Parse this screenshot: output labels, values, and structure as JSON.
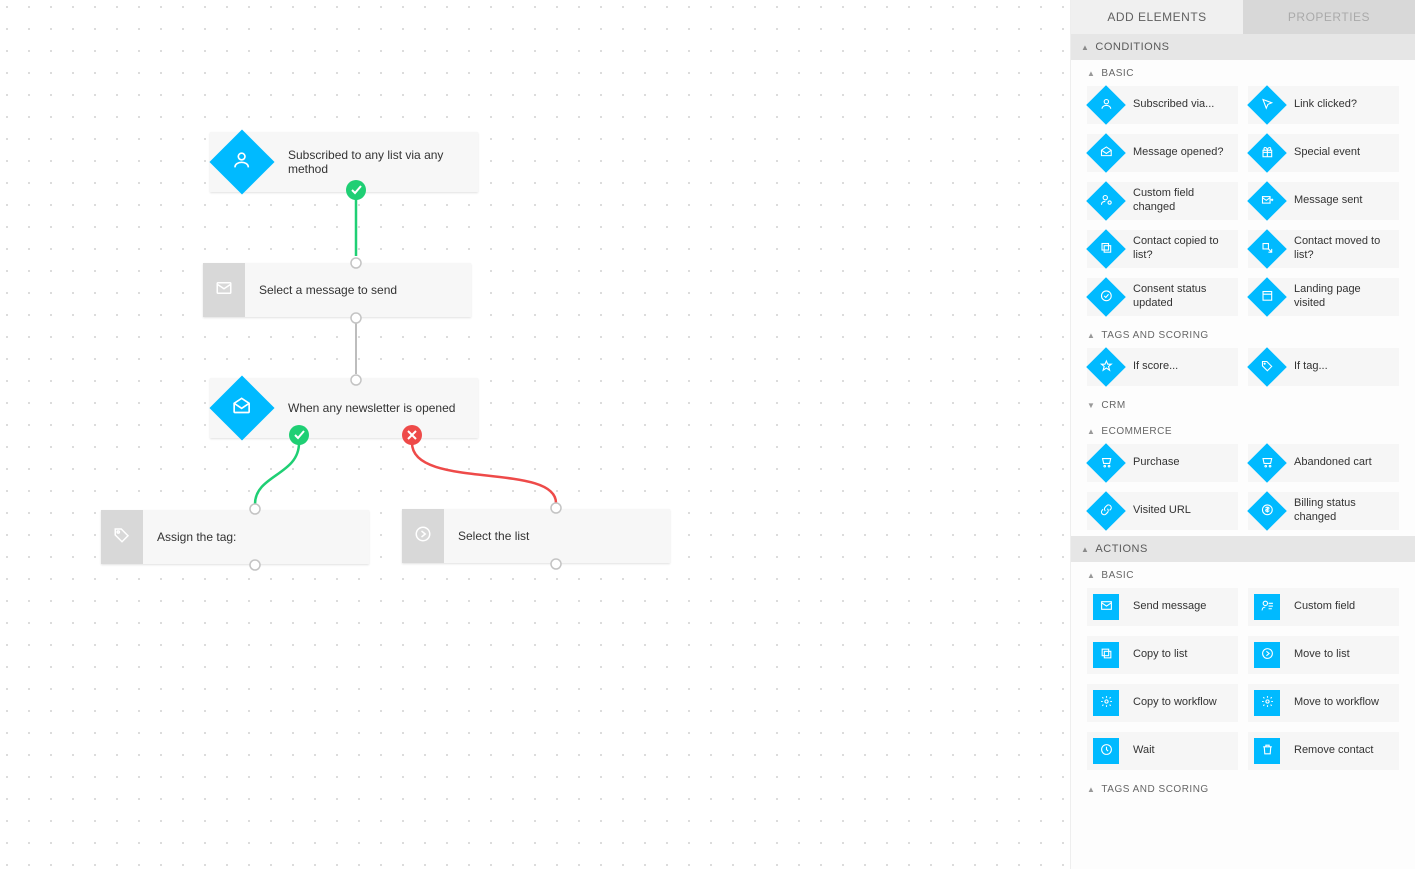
{
  "tabs": {
    "add": "ADD ELEMENTS",
    "props": "PROPERTIES"
  },
  "sections": {
    "conditions": "CONDITIONS",
    "actions": "ACTIONS",
    "basic": "BASIC",
    "tags_scoring": "TAGS AND SCORING",
    "crm": "CRM",
    "ecommerce": "ECOMMERCE"
  },
  "conditions": {
    "basic": [
      {
        "label": "Subscribed via...",
        "icon": "person"
      },
      {
        "label": "Link clicked?",
        "icon": "cursor"
      },
      {
        "label": "Message opened?",
        "icon": "mail-open"
      },
      {
        "label": "Special event",
        "icon": "gift"
      },
      {
        "label": "Custom field changed",
        "icon": "person-gear"
      },
      {
        "label": "Message sent",
        "icon": "mail-out"
      },
      {
        "label": "Contact copied to list?",
        "icon": "copy"
      },
      {
        "label": "Contact moved to list?",
        "icon": "move"
      },
      {
        "label": "Consent status updated",
        "icon": "check-circ"
      },
      {
        "label": "Landing page visited",
        "icon": "page"
      }
    ],
    "tags_scoring": [
      {
        "label": "If score...",
        "icon": "star"
      },
      {
        "label": "If tag...",
        "icon": "tag"
      }
    ],
    "ecommerce": [
      {
        "label": "Purchase",
        "icon": "cart-check"
      },
      {
        "label": "Abandoned cart",
        "icon": "cart"
      },
      {
        "label": "Visited URL",
        "icon": "link"
      },
      {
        "label": "Billing status changed",
        "icon": "dollar"
      }
    ]
  },
  "actions": {
    "basic": [
      {
        "label": "Send message",
        "icon": "mail"
      },
      {
        "label": "Custom field",
        "icon": "person-list"
      },
      {
        "label": "Copy to list",
        "icon": "copy"
      },
      {
        "label": "Move to list",
        "icon": "arrow-circ"
      },
      {
        "label": "Copy to workflow",
        "icon": "gear"
      },
      {
        "label": "Move to workflow",
        "icon": "gear"
      },
      {
        "label": "Wait",
        "icon": "clock"
      },
      {
        "label": "Remove contact",
        "icon": "trash"
      }
    ]
  },
  "canvas": {
    "n1": "Subscribed to any list via any method",
    "n2": "Select a message to send",
    "n3": "When any newsletter is opened",
    "n4": "Assign the tag:",
    "n5": "Select the list"
  },
  "colors": {
    "accent": "#00baff",
    "green": "#1fcf74",
    "red": "#ee4a49"
  }
}
